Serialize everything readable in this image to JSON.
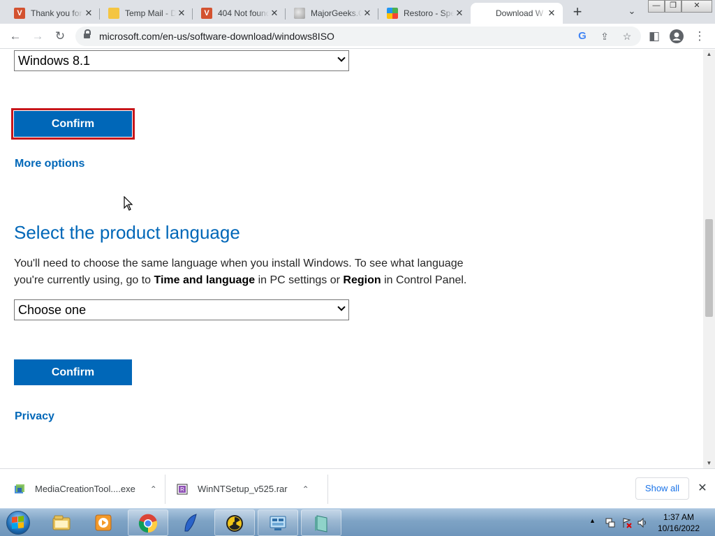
{
  "browser": {
    "tabs": [
      {
        "title": "Thank you for",
        "favicon": "vivaldi-v-icon"
      },
      {
        "title": "Temp Mail - D",
        "favicon": "temp-mail-icon"
      },
      {
        "title": "404 Not found",
        "favicon": "vivaldi-v-icon"
      },
      {
        "title": "MajorGeeks.C",
        "favicon": "majorgeeks-icon"
      },
      {
        "title": "Restoro - Spe",
        "favicon": "restoro-icon"
      },
      {
        "title": "Download W",
        "favicon": "microsoft-icon",
        "active": true
      }
    ],
    "url": "microsoft.com/en-us/software-download/windows8ISO"
  },
  "page": {
    "edition_select_value": "Windows 8.1",
    "confirm_label_1": "Confirm",
    "more_options": "More options",
    "language_heading": "Select the product language",
    "language_text_1": "You'll need to choose the same language when you install Windows. To see what language you're currently using, go to ",
    "language_text_bold_1": "Time and language",
    "language_text_2": " in PC settings or ",
    "language_text_bold_2": "Region",
    "language_text_3": " in Control Panel.",
    "language_select_value": "Choose one",
    "confirm_label_2": "Confirm",
    "privacy": "Privacy"
  },
  "downloads": {
    "items": [
      {
        "name": "MediaCreationTool....exe"
      },
      {
        "name": "WinNTSetup_v525.rar"
      }
    ],
    "show_all": "Show all"
  },
  "taskbar": {
    "time": "1:37 AM",
    "date": "10/16/2022"
  },
  "colors": {
    "accent": "#0067b8",
    "focus_outline": "#c7161b"
  }
}
